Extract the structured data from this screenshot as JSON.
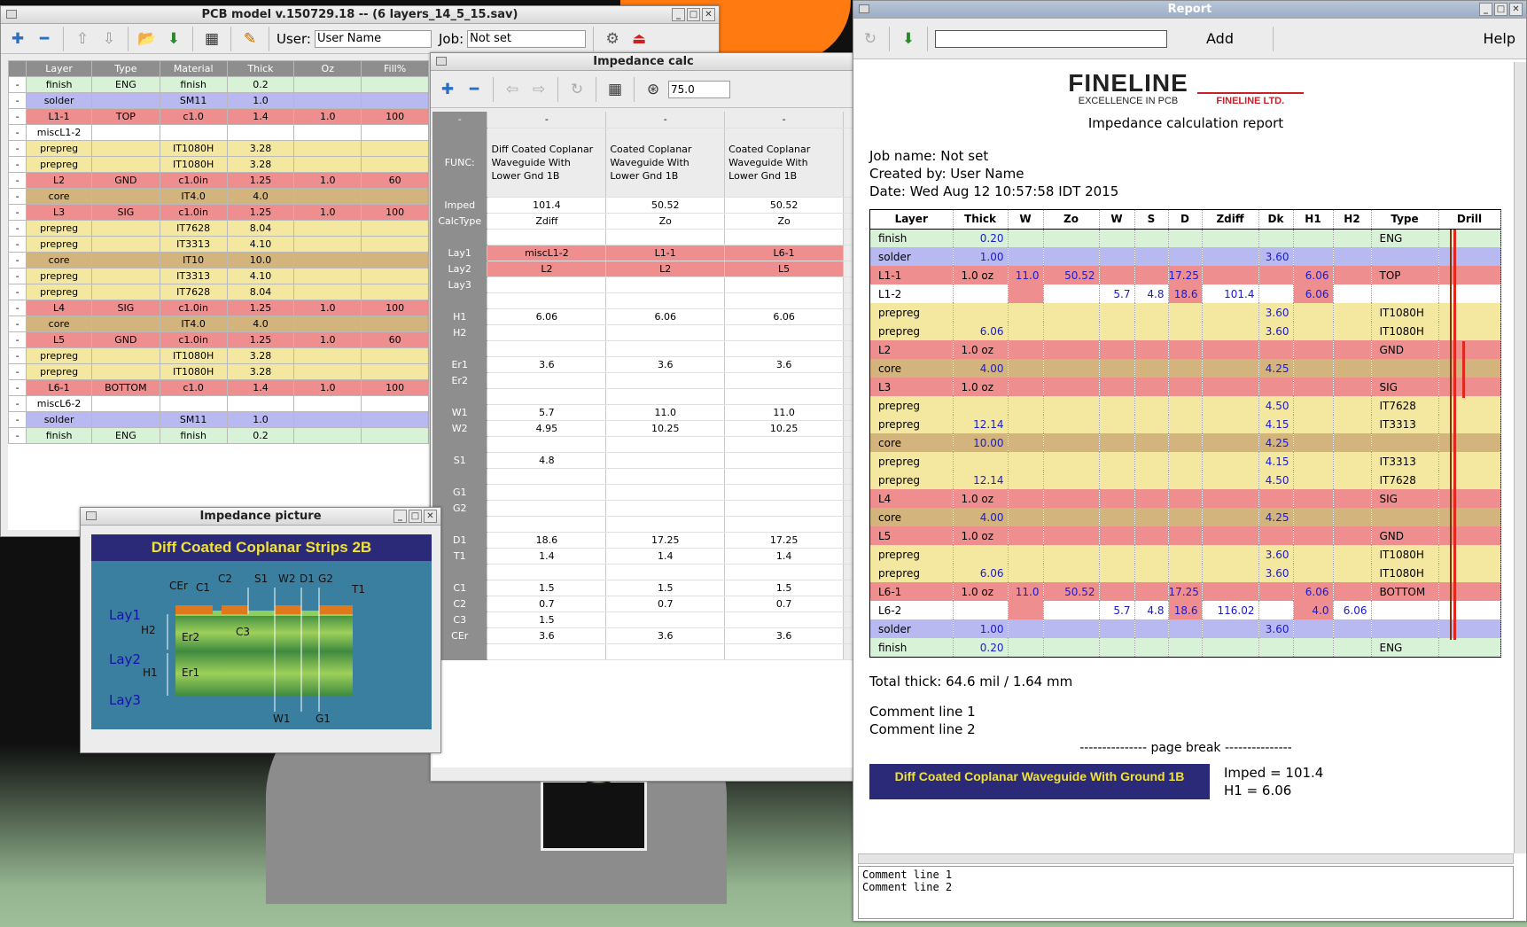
{
  "pcb_window": {
    "title": "PCB model v.150729.18 -- (6 layers_14_5_15.sav)",
    "user_label": "User:",
    "user_value": "User Name",
    "job_label": "Job:",
    "job_value": "Not set",
    "headers": [
      "",
      "Layer",
      "Type",
      "Material",
      "Thick",
      "Oz",
      "Fill%"
    ],
    "rows": [
      [
        "-",
        "finish",
        "ENG",
        "finish",
        "0.2",
        "",
        ""
      ],
      [
        "-",
        "solder",
        "",
        "SM11",
        "1.0",
        "",
        ""
      ],
      [
        "-",
        "L1-1",
        "TOP",
        "c1.0",
        "1.4",
        "1.0",
        "100"
      ],
      [
        "-",
        "miscL1-2",
        "",
        "",
        "",
        "",
        ""
      ],
      [
        "-",
        "prepreg",
        "",
        "IT1080H",
        "3.28",
        "",
        ""
      ],
      [
        "-",
        "prepreg",
        "",
        "IT1080H",
        "3.28",
        "",
        ""
      ],
      [
        "-",
        "L2",
        "GND",
        "c1.0in",
        "1.25",
        "1.0",
        "60"
      ],
      [
        "-",
        "core",
        "",
        "IT4.0",
        "4.0",
        "",
        ""
      ],
      [
        "-",
        "L3",
        "SIG",
        "c1.0in",
        "1.25",
        "1.0",
        "100"
      ],
      [
        "-",
        "prepreg",
        "",
        "IT7628",
        "8.04",
        "",
        ""
      ],
      [
        "-",
        "prepreg",
        "",
        "IT3313",
        "4.10",
        "",
        ""
      ],
      [
        "-",
        "core",
        "",
        "IT10",
        "10.0",
        "",
        ""
      ],
      [
        "-",
        "prepreg",
        "",
        "IT3313",
        "4.10",
        "",
        ""
      ],
      [
        "-",
        "prepreg",
        "",
        "IT7628",
        "8.04",
        "",
        ""
      ],
      [
        "-",
        "L4",
        "SIG",
        "c1.0in",
        "1.25",
        "1.0",
        "100"
      ],
      [
        "-",
        "core",
        "",
        "IT4.0",
        "4.0",
        "",
        ""
      ],
      [
        "-",
        "L5",
        "GND",
        "c1.0in",
        "1.25",
        "1.0",
        "60"
      ],
      [
        "-",
        "prepreg",
        "",
        "IT1080H",
        "3.28",
        "",
        ""
      ],
      [
        "-",
        "prepreg",
        "",
        "IT1080H",
        "3.28",
        "",
        ""
      ],
      [
        "-",
        "L6-1",
        "BOTTOM",
        "c1.0",
        "1.4",
        "1.0",
        "100"
      ],
      [
        "-",
        "miscL6-2",
        "",
        "",
        "",
        "",
        ""
      ],
      [
        "-",
        "solder",
        "",
        "SM11",
        "1.0",
        "",
        ""
      ],
      [
        "-",
        "finish",
        "ENG",
        "finish",
        "0.2",
        "",
        ""
      ]
    ]
  },
  "imp_window": {
    "title": "Impedance calc",
    "zoom": "75.0",
    "col_heads": [
      "-",
      "-",
      "-",
      "-"
    ],
    "func_label": "FUNC:",
    "funcs": [
      "Diff Coated Coplanar Waveguide With Lower Gnd 1B",
      "Coated Coplanar Waveguide With Lower Gnd 1B",
      "Coated Coplanar Waveguide With Lower Gnd 1B"
    ],
    "rows": [
      {
        "k": "Imped",
        "v": [
          "101.4",
          "50.52",
          "50.52"
        ]
      },
      {
        "k": "CalcType",
        "v": [
          "Zdiff",
          "Zo",
          "Zo"
        ]
      },
      {
        "k": "",
        "v": [
          "",
          "",
          ""
        ]
      },
      {
        "k": "Lay1",
        "v": [
          "miscL1-2",
          "L1-1",
          "L6-1"
        ],
        "red": true
      },
      {
        "k": "Lay2",
        "v": [
          "L2",
          "L2",
          "L5"
        ],
        "red": true
      },
      {
        "k": "Lay3",
        "v": [
          "",
          "",
          ""
        ]
      },
      {
        "k": "",
        "v": [
          "",
          "",
          ""
        ]
      },
      {
        "k": "H1",
        "v": [
          "6.06",
          "6.06",
          "6.06"
        ]
      },
      {
        "k": "H2",
        "v": [
          "",
          "",
          ""
        ]
      },
      {
        "k": "",
        "v": [
          "",
          "",
          ""
        ]
      },
      {
        "k": "Er1",
        "v": [
          "3.6",
          "3.6",
          "3.6"
        ]
      },
      {
        "k": "Er2",
        "v": [
          "",
          "",
          ""
        ]
      },
      {
        "k": "",
        "v": [
          "",
          "",
          ""
        ]
      },
      {
        "k": "W1",
        "v": [
          "5.7",
          "11.0",
          "11.0"
        ]
      },
      {
        "k": "W2",
        "v": [
          "4.95",
          "10.25",
          "10.25"
        ]
      },
      {
        "k": "",
        "v": [
          "",
          "",
          ""
        ]
      },
      {
        "k": "S1",
        "v": [
          "4.8",
          "",
          ""
        ]
      },
      {
        "k": "",
        "v": [
          "",
          "",
          ""
        ]
      },
      {
        "k": "G1",
        "v": [
          "",
          "",
          ""
        ]
      },
      {
        "k": "G2",
        "v": [
          "",
          "",
          ""
        ]
      },
      {
        "k": "",
        "v": [
          "",
          "",
          ""
        ]
      },
      {
        "k": "D1",
        "v": [
          "18.6",
          "17.25",
          "17.25"
        ]
      },
      {
        "k": "T1",
        "v": [
          "1.4",
          "1.4",
          "1.4"
        ]
      },
      {
        "k": "",
        "v": [
          "",
          "",
          ""
        ]
      },
      {
        "k": "C1",
        "v": [
          "1.5",
          "1.5",
          "1.5"
        ]
      },
      {
        "k": "C2",
        "v": [
          "0.7",
          "0.7",
          "0.7"
        ]
      },
      {
        "k": "C3",
        "v": [
          "1.5",
          "",
          ""
        ]
      },
      {
        "k": "CEr",
        "v": [
          "3.6",
          "3.6",
          "3.6"
        ]
      },
      {
        "k": "",
        "v": [
          "",
          "",
          ""
        ]
      }
    ]
  },
  "pic_window": {
    "title": "Impedance picture",
    "banner": "Diff Coated Coplanar Strips 2B",
    "labels": {
      "cer": "CEr",
      "c1": "C1",
      "c2": "C2",
      "s1": "S1",
      "w2": "W2",
      "d1": "D1",
      "g2": "G2",
      "t1": "T1",
      "lay1": "Lay1",
      "h2": "H2",
      "er2": "Er2",
      "c3": "C3",
      "lay2": "Lay2",
      "h1": "H1",
      "er1": "Er1",
      "lay3": "Lay3",
      "w1": "W1",
      "g1": "G1"
    }
  },
  "report": {
    "title": "Report",
    "add": "Add",
    "help": "Help",
    "logo_main": "FINELINE",
    "logo_sub": "EXCELLENCE IN PCB",
    "logo_ltd": "FINELINE LTD.",
    "heading": "Impedance calculation report",
    "job": "Job name: Not set",
    "created": "Created by: User Name",
    "date": "Date: Wed Aug 12 10:57:58 IDT 2015",
    "headers": [
      "Layer",
      "Thick",
      "W",
      "Zo",
      "W",
      "S",
      "D",
      "Zdiff",
      "Dk",
      "H1",
      "H2",
      "Type",
      "Drill"
    ],
    "rows": [
      {
        "c": "finish",
        "v": [
          "finish",
          "0.20",
          "",
          "",
          "",
          "",
          "",
          "",
          "",
          "",
          "",
          "ENG"
        ]
      },
      {
        "c": "solder",
        "v": [
          "solder",
          "1.00",
          "",
          "",
          "",
          "",
          "",
          "",
          "3.60",
          "",
          "",
          ""
        ]
      },
      {
        "c": "cu",
        "v": [
          "L1-1",
          "1.0 oz",
          "11.0",
          "50.52",
          "",
          "",
          "17.25",
          "",
          "",
          "6.06",
          "",
          "TOP"
        ]
      },
      {
        "c": "misc",
        "v": [
          "L1-2",
          "",
          "",
          "",
          "5.7",
          "4.8",
          "18.6",
          "101.4",
          "",
          "6.06",
          "",
          ""
        ]
      },
      {
        "c": "pre",
        "v": [
          "prepreg",
          "",
          "",
          "",
          "",
          "",
          "",
          "",
          "3.60",
          "",
          "",
          "IT1080H"
        ]
      },
      {
        "c": "pre",
        "v": [
          "prepreg",
          "6.06",
          "",
          "",
          "",
          "",
          "",
          "",
          "3.60",
          "",
          "",
          "IT1080H"
        ]
      },
      {
        "c": "cu",
        "v": [
          "L2",
          "1.0 oz",
          "",
          "",
          "",
          "",
          "",
          "",
          "",
          "",
          "",
          "GND"
        ]
      },
      {
        "c": "core",
        "v": [
          "core",
          "4.00",
          "",
          "",
          "",
          "",
          "",
          "",
          "4.25",
          "",
          "",
          ""
        ]
      },
      {
        "c": "cu",
        "v": [
          "L3",
          "1.0 oz",
          "",
          "",
          "",
          "",
          "",
          "",
          "",
          "",
          "",
          "SIG"
        ]
      },
      {
        "c": "pre",
        "v": [
          "prepreg",
          "",
          "",
          "",
          "",
          "",
          "",
          "",
          "4.50",
          "",
          "",
          "IT7628"
        ]
      },
      {
        "c": "pre",
        "v": [
          "prepreg",
          "12.14",
          "",
          "",
          "",
          "",
          "",
          "",
          "4.15",
          "",
          "",
          "IT3313"
        ]
      },
      {
        "c": "core",
        "v": [
          "core",
          "10.00",
          "",
          "",
          "",
          "",
          "",
          "",
          "4.25",
          "",
          "",
          ""
        ]
      },
      {
        "c": "pre",
        "v": [
          "prepreg",
          "",
          "",
          "",
          "",
          "",
          "",
          "",
          "4.15",
          "",
          "",
          "IT3313"
        ]
      },
      {
        "c": "pre",
        "v": [
          "prepreg",
          "12.14",
          "",
          "",
          "",
          "",
          "",
          "",
          "4.50",
          "",
          "",
          "IT7628"
        ]
      },
      {
        "c": "cu",
        "v": [
          "L4",
          "1.0 oz",
          "",
          "",
          "",
          "",
          "",
          "",
          "",
          "",
          "",
          "SIG"
        ]
      },
      {
        "c": "core",
        "v": [
          "core",
          "4.00",
          "",
          "",
          "",
          "",
          "",
          "",
          "4.25",
          "",
          "",
          ""
        ]
      },
      {
        "c": "cu",
        "v": [
          "L5",
          "1.0 oz",
          "",
          "",
          "",
          "",
          "",
          "",
          "",
          "",
          "",
          "GND"
        ]
      },
      {
        "c": "pre",
        "v": [
          "prepreg",
          "",
          "",
          "",
          "",
          "",
          "",
          "",
          "3.60",
          "",
          "",
          "IT1080H"
        ]
      },
      {
        "c": "pre",
        "v": [
          "prepreg",
          "6.06",
          "",
          "",
          "",
          "",
          "",
          "",
          "3.60",
          "",
          "",
          "IT1080H"
        ]
      },
      {
        "c": "cu",
        "v": [
          "L6-1",
          "1.0 oz",
          "11.0",
          "50.52",
          "",
          "",
          "17.25",
          "",
          "",
          "6.06",
          "",
          "BOTTOM"
        ]
      },
      {
        "c": "misc",
        "v": [
          "L6-2",
          "",
          "",
          "",
          "5.7",
          "4.8",
          "18.6",
          "116.02",
          "",
          "4.0",
          "6.06",
          ""
        ]
      },
      {
        "c": "solder",
        "v": [
          "solder",
          "1.00",
          "",
          "",
          "",
          "",
          "",
          "",
          "3.60",
          "",
          "",
          ""
        ]
      },
      {
        "c": "finish",
        "v": [
          "finish",
          "0.20",
          "",
          "",
          "",
          "",
          "",
          "",
          "",
          "",
          "",
          "ENG"
        ]
      }
    ],
    "total": "Total thick: 64.6 mil / 1.64 mm",
    "comment1": "Comment line 1",
    "comment2": "Comment line 2",
    "page_break": "--------------- page break ---------------",
    "banner2": "Diff Coated Coplanar Waveguide With Ground 1B",
    "imped": "Imped = 101.4",
    "h1": "H1 = 6.06",
    "bottom1": "Comment line 1",
    "bottom2": "Comment line 2"
  },
  "colors": {
    "finish": "#d8f2d8",
    "solder": "#b9b9f2",
    "copper": "#ef8e8e",
    "prepreg": "#f4e8a0",
    "core": "#d4b47d",
    "accent": "#2a6fc2"
  }
}
